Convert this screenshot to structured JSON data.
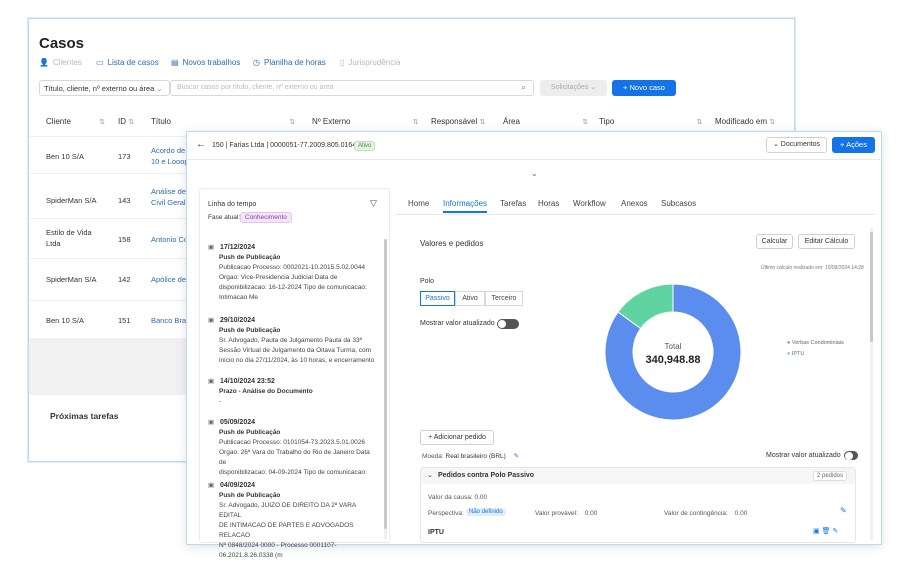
{
  "back": {
    "title": "Casos",
    "nav": [
      {
        "label": "Clientes",
        "icon": "user-icon",
        "dim": true
      },
      {
        "label": "Lista de casos",
        "icon": "folder-icon",
        "dim": false
      },
      {
        "label": "Novos trabalhos",
        "icon": "document-icon",
        "dim": false
      },
      {
        "label": "Planilha de horas",
        "icon": "clock-icon",
        "dim": false
      },
      {
        "label": "Jurisprudência",
        "icon": "book-icon",
        "dim": true
      }
    ],
    "filter_select": "Título, cliente, nº externo ou área",
    "search_placeholder": "Buscar casos por título, cliente, nº externo ou área",
    "solicitacoes_label": "Solicitações",
    "novo_caso_label": "+ Novo caso",
    "columns": [
      "Cliente",
      "ID",
      "Título",
      "Nº Externo",
      "Responsável",
      "Área",
      "Tipo",
      "Modificado em"
    ],
    "rows": [
      {
        "cliente": "Ben 10 S/A",
        "id": "173",
        "titulo": "Acordo de",
        "titulo2": "10 e Looop"
      },
      {
        "cliente": "SpiderMan S/A",
        "id": "143",
        "titulo": "Análise de",
        "titulo2": "Civil Geral"
      },
      {
        "cliente": "Estilo de Vida",
        "cliente2": "Ltda",
        "id": "158",
        "titulo": "Antonio Co",
        "titulo2": ""
      },
      {
        "cliente": "SpiderMan S/A",
        "id": "142",
        "titulo": "Apólice de",
        "titulo2": ""
      },
      {
        "cliente": "Ben 10 S/A",
        "id": "151",
        "titulo": "Banco Brad",
        "titulo2": ""
      }
    ],
    "proximas": "Próximas tarefas"
  },
  "front": {
    "case_title": "150 | Farias Ltda | 0000051-77.2009.805.0164",
    "status": "Ativo",
    "documentos_label": "Documentos",
    "acoes_label": "+ Ações",
    "timeline": {
      "title": "Linha do tempo",
      "fase_label": "Fase atual:",
      "fase_value": "Conhecimento",
      "items": [
        {
          "date": "17/12/2024",
          "type": "Push de Publicação",
          "body": [
            "Publicacao Processo: 0002021-10.2015.5.02.0044",
            "Orgao: Vice-Presidencia Judicial Data de",
            "disponibilizacao: 16-12-2024 Tipo de comunicacao:",
            "Intimacao Me"
          ]
        },
        {
          "date": "29/10/2024",
          "type": "Push de Publicação",
          "body": [
            "Sr. Advogado, Pauta de Julgamento Pauta da 33ª",
            "Sessão Virtual de Julgamento da Oitava Turma, com",
            "início no dia 27/11/2024, às 10 horas, e encerramento"
          ]
        },
        {
          "date": "14/10/2024 23:52",
          "type": "Prazo - Análise do Documento",
          "body": [
            "-"
          ]
        },
        {
          "date": "05/09/2024",
          "type": "Push de Publicação",
          "body": [
            "Publicacao Processo: 0101054-73.2023.5.01.0026",
            "Orgao: 26ª Vara do Trabalho do Rio de Janeiro Data de",
            "disponibilizacao: 04-09-2024 Tipo de comunicacao:"
          ]
        },
        {
          "date": "04/09/2024",
          "type": "Push de Publicação",
          "body": [
            "Sr. Advogado, JUIZO DE DIREITO DA 2ª VARA EDITAL",
            "DE INTIMACAO DE PARTES E ADVOGADOS RELACAO",
            "Nº 0848/2024 0000 - Processo 0001107-",
            "06.2021.8.26.0338 (m"
          ]
        }
      ]
    },
    "tabs": [
      "Home",
      "Informações",
      "Tarefas",
      "Horas",
      "Workflow",
      "Anexos",
      "Subcasos"
    ],
    "active_tab": "Informações",
    "valores": {
      "title": "Valores e pedidos",
      "calcular": "Calcular",
      "editar": "Editar Cálculo",
      "ultimo_calculo": "Último cálculo realizado em: 10/09/2024 14:28",
      "polo_label": "Polo",
      "polo_options": [
        "Passivo",
        "Ativo",
        "Terceiro"
      ],
      "polo_selected": "Passivo",
      "mostrar_label": "Mostrar valor atualizado",
      "total_label": "Total",
      "total_value": "340,948.88",
      "adicionar_pedido": "+ Adicionar pedido",
      "moeda_label": "Moeda:",
      "moeda_value": "Real brasileiro (BRL)",
      "mostrar_label2": "Mostrar valor atualizado",
      "pedidos_title": "Pedidos contra Polo Passivo",
      "pedidos_count": "2 pedidos",
      "valor_causa_label": "Valor da causa:",
      "valor_causa": "0.00",
      "perspectiva_label": "Perspectiva:",
      "perspectiva_value": "Não definido",
      "valor_provavel_label": "Valor provável:",
      "valor_provavel": "0.00",
      "valor_contingencia_label": "Valor de contingência:",
      "valor_contingencia": "0.00",
      "pedido_name": "IPTU"
    },
    "chart_data": {
      "type": "pie",
      "donut": true,
      "categories": [
        "Verbas Condominiais",
        "IPTU"
      ],
      "values": [
        85,
        15
      ],
      "colors": [
        "#5b8def",
        "#5fd3a0"
      ],
      "center_label": "Total",
      "center_value": "340,948.88",
      "legend_position": "right"
    }
  }
}
